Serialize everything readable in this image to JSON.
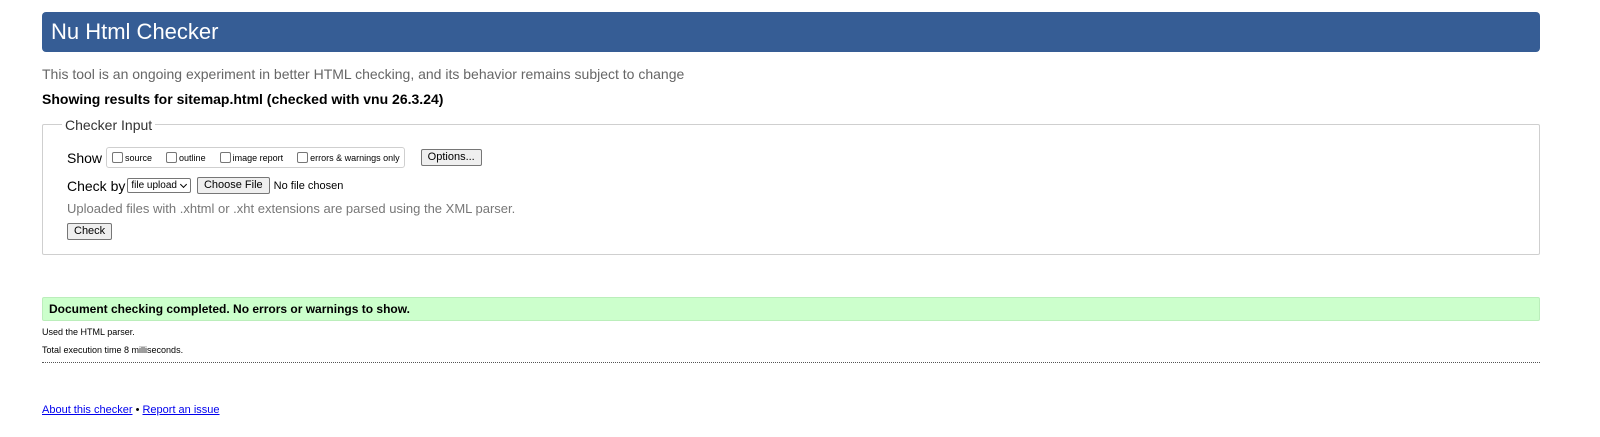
{
  "header": {
    "title": "Nu Html Checker"
  },
  "tagline": "This tool is an ongoing experiment in better HTML checking, and its behavior remains subject to change",
  "results_heading": "Showing results for sitemap.html (checked with vnu 26.3.24)",
  "checker_input": {
    "legend": "Checker Input",
    "show_label": "Show",
    "show_options": [
      {
        "label": "source",
        "checked": false
      },
      {
        "label": "outline",
        "checked": false
      },
      {
        "label": "image report",
        "checked": false
      },
      {
        "label": "errors & warnings only",
        "checked": false
      }
    ],
    "options_button": "Options...",
    "check_by_label": "Check by",
    "check_by_selected": "file upload",
    "choose_file_button": "Choose File",
    "no_file_text": "No file chosen",
    "note": "Uploaded files with .xhtml or .xht extensions are parsed using the XML parser.",
    "check_button": "Check"
  },
  "result": {
    "success_message": "Document checking completed. No errors or warnings to show.",
    "parser_info": "Used the HTML parser.",
    "execution_time": "Total execution time 8 milliseconds."
  },
  "footer": {
    "about_link": "About this checker",
    "separator": "•",
    "report_link": "Report an issue"
  },
  "colors": {
    "header_bg": "#365d95",
    "success_bg": "#ccffcc",
    "link": "#0000ee"
  }
}
